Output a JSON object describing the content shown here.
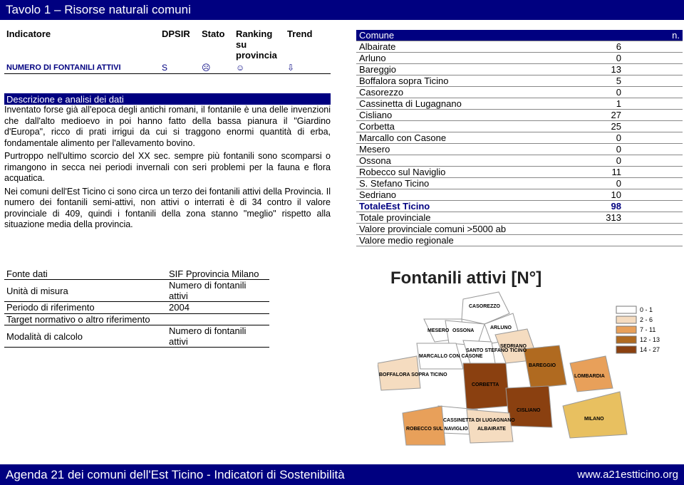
{
  "title": "Tavolo 1 – Risorse naturali comuni",
  "indicator_table": {
    "headers": {
      "indicatore": "Indicatore",
      "dpsir": "DPSIR",
      "stato": "Stato",
      "ranking": "Ranking su provincia",
      "trend": "Trend"
    },
    "row": {
      "name": "NUMERO DI FONTANILI ATTIVI",
      "dpsir": "S",
      "stato": "☹",
      "ranking": "☺",
      "trend": "⇩"
    }
  },
  "description": {
    "heading": "Descrizione e analisi dei dati",
    "paragraphs": [
      "Inventato forse già all'epoca degli antichi romani, il fontanile è una delle invenzioni che dall'alto medioevo in poi hanno fatto della bassa pianura il \"Giardino d'Europa\", ricco di prati irrigui da cui si traggono enormi quantità di erba, fondamentale alimento per l'allevamento bovino.",
      "Purtroppo nell'ultimo scorcio del XX sec. sempre più fontanili sono scomparsi o rimangono in secca nei periodi invernali con seri problemi per la fauna e flora acquatica.",
      "Nei comuni dell'Est Ticino ci sono circa un terzo dei fontanili attivi della Provincia. Il numero dei fontanili semi-attivi, non attivi o interrati è di 34 contro il valore provinciale di 409, quindi i fontanili della zona stanno \"meglio\" rispetto alla situazione media della provincia."
    ]
  },
  "municipalities": {
    "header": {
      "comune": "Comune",
      "n": "n."
    },
    "rows": [
      {
        "name": "Albairate",
        "n": "6"
      },
      {
        "name": "Arluno",
        "n": "0"
      },
      {
        "name": "Bareggio",
        "n": "13"
      },
      {
        "name": "Boffalora sopra Ticino",
        "n": "5"
      },
      {
        "name": "Casorezzo",
        "n": "0"
      },
      {
        "name": "Cassinetta di Lugagnano",
        "n": "1"
      },
      {
        "name": "Cisliano",
        "n": "27"
      },
      {
        "name": "Corbetta",
        "n": "25"
      },
      {
        "name": "Marcallo con Casone",
        "n": "0"
      },
      {
        "name": "Mesero",
        "n": "0"
      },
      {
        "name": "Ossona",
        "n": "0"
      },
      {
        "name": "Robecco sul Naviglio",
        "n": "11"
      },
      {
        "name": "S. Stefano Ticino",
        "n": "0"
      },
      {
        "name": "Sedriano",
        "n": "10"
      }
    ],
    "total_est": {
      "name": "TotaleEst Ticino",
      "n": "98"
    },
    "total_prov": {
      "name": "Totale provinciale",
      "n": "313"
    },
    "prov_5000": {
      "name": "Valore provinciale comuni >5000 ab",
      "n": ""
    },
    "regional": {
      "name": "Valore medio regionale",
      "n": ""
    }
  },
  "metadata": [
    {
      "k": "Fonte dati",
      "v": "SIF Pprovincia Milano"
    },
    {
      "k": "Unità di misura",
      "v": "Numero di fontanili attivi"
    },
    {
      "k": "Periodo di riferimento",
      "v": "2004"
    },
    {
      "k": "Target normativo o altro riferimento",
      "v": ""
    },
    {
      "k": "Modalità di calcolo",
      "v": "Numero di fontanili attivi"
    }
  ],
  "map": {
    "title": "Fontanili attivi [N°]",
    "legend": [
      "0 - 1",
      "2 - 6",
      "7 - 11",
      "12 - 13",
      "14 - 27"
    ],
    "legend_colors": [
      "#ffffff",
      "#f5dcc0",
      "#e8a05a",
      "#b06a20",
      "#8a4010"
    ],
    "labels": [
      "CASOREZZO",
      "MESERO",
      "OSSONA",
      "ARLUNO",
      "SANTO STEFANO TICINO",
      "SEDRIANO",
      "MARCALLO CON CASONE",
      "BAREGGIO",
      "BOFFALORA SOPRA TICINO",
      "CORBETTA",
      "LOMBARDIA",
      "CASSINETTA DI LUGAGNANO",
      "CISLIANO",
      "ROBECCO SUL NAVIGLIO",
      "ALBAIRATE",
      "MILANO"
    ]
  },
  "footer": {
    "left": "Agenda 21 dei comuni dell'Est Ticino - Indicatori di Sostenibilità",
    "right": "www.a21estticino.org"
  }
}
